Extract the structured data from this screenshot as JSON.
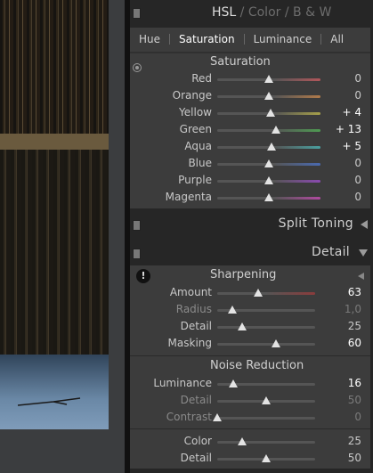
{
  "hsl_header": {
    "hsl": "HSL",
    "sep1": " / ",
    "color": "Color",
    "sep2": " / ",
    "bw": "B & W"
  },
  "tabs": [
    "Hue",
    "Saturation",
    "Luminance",
    "All"
  ],
  "saturation": {
    "title": "Saturation",
    "rows": [
      {
        "label": "Red",
        "value": "0",
        "level": 0,
        "color": "#b0565a"
      },
      {
        "label": "Orange",
        "value": "0",
        "level": 0,
        "color": "#b07a4a"
      },
      {
        "label": "Yellow",
        "value": "+ 4",
        "level": 4,
        "color": "#a6a04a"
      },
      {
        "label": "Green",
        "value": "+ 13",
        "level": 13,
        "color": "#4e9a52"
      },
      {
        "label": "Aqua",
        "value": "+ 5",
        "level": 5,
        "color": "#4aa0a0"
      },
      {
        "label": "Blue",
        "value": "0",
        "level": 0,
        "color": "#4a6ab0"
      },
      {
        "label": "Purple",
        "value": "0",
        "level": 0,
        "color": "#8a4ab0"
      },
      {
        "label": "Magenta",
        "value": "0",
        "level": 0,
        "color": "#b04aa0"
      }
    ]
  },
  "split_toning": {
    "title": "Split Toning"
  },
  "detail": {
    "title": "Detail",
    "sharpening": {
      "title": "Sharpening",
      "rows": [
        {
          "label": "Amount",
          "value": "63",
          "fraction": 0.42,
          "style": "bright"
        },
        {
          "label": "Radius",
          "value": "1,0",
          "fraction": 0.15,
          "style": "dim"
        },
        {
          "label": "Detail",
          "value": "25",
          "fraction": 0.25,
          "style": "normal"
        },
        {
          "label": "Masking",
          "value": "60",
          "fraction": 0.6,
          "style": "bright"
        }
      ]
    },
    "noise_reduction": {
      "title": "Noise Reduction",
      "rows": [
        {
          "label": "Luminance",
          "value": "16",
          "fraction": 0.16,
          "style": "bright"
        },
        {
          "label": "Detail",
          "value": "50",
          "fraction": 0.5,
          "style": "dim"
        },
        {
          "label": "Contrast",
          "value": "0",
          "fraction": 0.0,
          "style": "dim"
        },
        {
          "label": "Color",
          "value": "25",
          "fraction": 0.25,
          "style": "normal"
        },
        {
          "label": "Detail",
          "value": "50",
          "fraction": 0.5,
          "style": "normal"
        }
      ]
    }
  }
}
